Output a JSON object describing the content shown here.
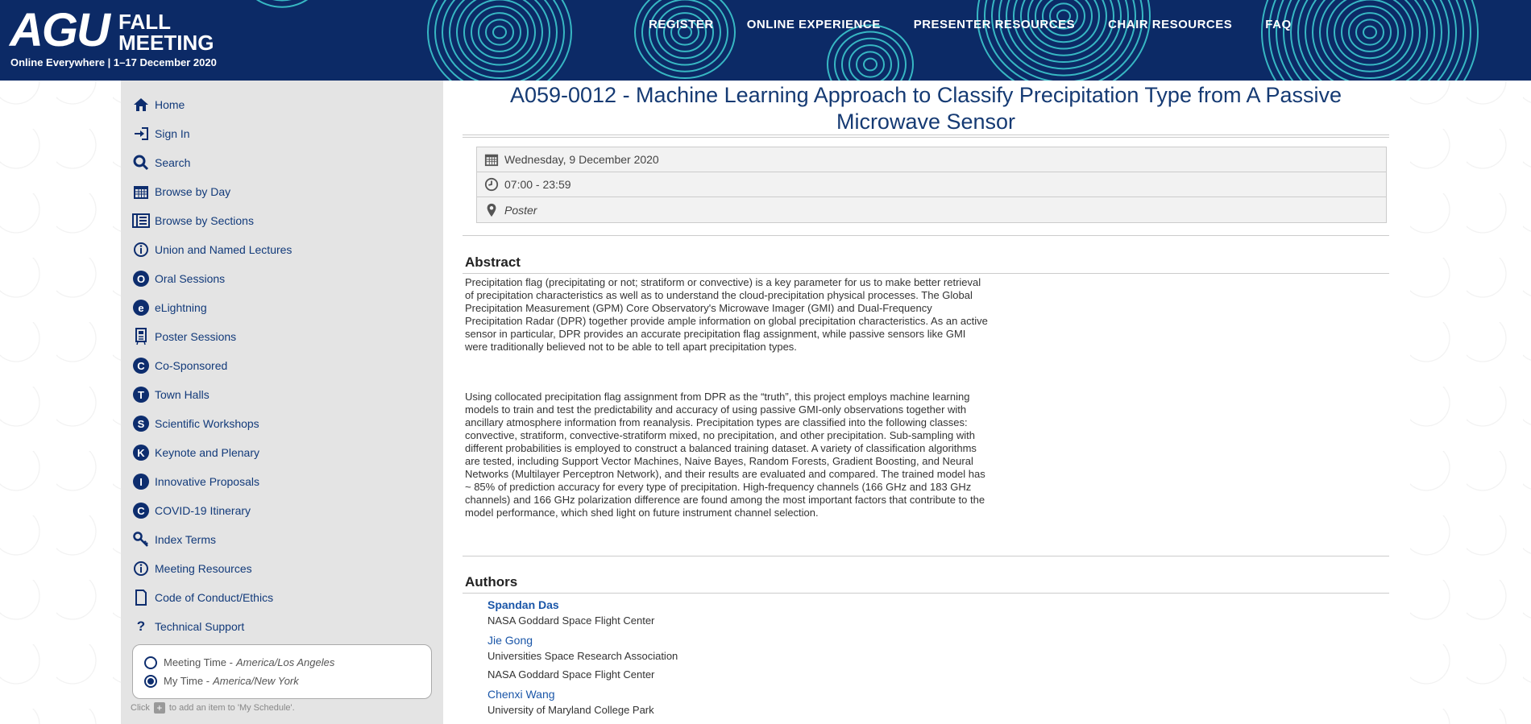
{
  "header": {
    "logo_text": "AGU",
    "logo_event_line1": "FALL",
    "logo_event_line2": "MEETING",
    "tagline": "Online Everywhere  |  1–17 December 2020",
    "nav": [
      "REGISTER",
      "ONLINE EXPERIENCE",
      "PRESENTER RESOURCES",
      "CHAIR RESOURCES",
      "FAQ"
    ],
    "bg_color": "#0c2a66",
    "ring_color": "#3fd0d4"
  },
  "sidebar": {
    "items": [
      {
        "label": "Home",
        "icon": "home-icon"
      },
      {
        "label": "Sign In",
        "icon": "sign-in-icon"
      },
      {
        "label": "Search",
        "icon": "search-icon"
      },
      {
        "label": "Browse by Day",
        "icon": "calendar-icon"
      },
      {
        "label": "Browse by Sections",
        "icon": "sections-icon"
      },
      {
        "label": "Union and Named Lectures",
        "icon": "info-icon"
      },
      {
        "label": "Oral Sessions",
        "icon": "O"
      },
      {
        "label": "eLightning",
        "icon": "e"
      },
      {
        "label": "Poster Sessions",
        "icon": "poster-icon"
      },
      {
        "label": "Co-Sponsored",
        "icon": "C"
      },
      {
        "label": "Town Halls",
        "icon": "T"
      },
      {
        "label": "Scientific Workshops",
        "icon": "S"
      },
      {
        "label": "Keynote and Plenary",
        "icon": "K"
      },
      {
        "label": "Innovative Proposals",
        "icon": "I"
      },
      {
        "label": "COVID-19 Itinerary",
        "icon": "C"
      },
      {
        "label": "Index Terms",
        "icon": "key-icon"
      },
      {
        "label": "Meeting Resources",
        "icon": "info-icon"
      },
      {
        "label": "Code of Conduct/Ethics",
        "icon": "document-icon"
      },
      {
        "label": "Technical Support",
        "icon": "question-icon"
      }
    ],
    "timezone": {
      "meeting_label": "Meeting Time - ",
      "meeting_zone": "America/Los Angeles",
      "my_label": "My Time - ",
      "my_zone": "America/New York",
      "selected": "my"
    },
    "hint_before": "Click",
    "hint_after": "to add an item to 'My Schedule'."
  },
  "main": {
    "title": "A059-0012 - Machine Learning Approach to Classify Precipitation Type from A Passive Microwave Sensor",
    "date": "Wednesday, 9 December 2020",
    "time": "07:00 - 23:59",
    "location": "Poster",
    "abstract_heading": "Abstract",
    "abstract_p1": "Precipitation flag (precipitating or not; stratiform or convective) is a key parameter for us to make better retrieval of precipitation characteristics as well as to understand the cloud-precipitation physical processes. The Global Precipitation Measurement (GPM) Core Observatory's Microwave Imager (GMI) and Dual-Frequency Precipitation Radar (DPR) together provide ample information on global precipitation characteristics. As an active sensor in particular, DPR provides an accurate precipitation flag assignment, while passive sensors like GMI were traditionally believed not to be able to tell apart precipitation types.",
    "abstract_p2": "Using collocated precipitation flag assignment from DPR as the “truth”, this project employs machine learning models to train and test the predictability and accuracy of using passive GMI-only observations together with ancillary atmosphere information from reanalysis. Precipitation types are classified into the following classes: convective, stratiform, convective-stratiform mixed, no precipitation, and other precipitation. Sub-sampling with different probabilities is employed to construct a balanced training dataset. A variety of classification algorithms are tested, including Support Vector Machines, Naive Bayes, Random Forests, Gradient Boosting, and Neural Networks (Multilayer Perceptron Network), and their results are evaluated and compared. The trained model has ~ 85% of prediction accuracy for every type of precipitation. High-frequency channels (166 GHz and 183 GHz channels) and 166 GHz polarization difference are found among the most important factors that contribute to the model performance, which shed light on future instrument channel selection.",
    "authors_heading": "Authors",
    "authors": [
      {
        "name": "Spandan Das",
        "presenter": true,
        "affiliations": [
          "NASA Goddard Space Flight Center"
        ]
      },
      {
        "name": "Jie Gong",
        "presenter": false,
        "affiliations": [
          "Universities Space Research Association",
          "NASA Goddard Space Flight Center"
        ]
      },
      {
        "name": "Chenxi Wang",
        "presenter": false,
        "affiliations": [
          "University of Maryland College Park"
        ]
      }
    ]
  }
}
